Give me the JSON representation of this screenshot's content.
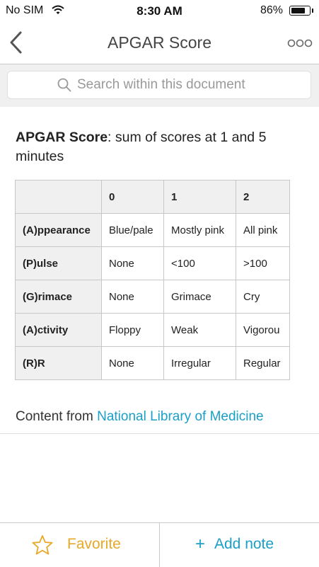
{
  "status_bar": {
    "carrier": "No SIM",
    "time": "8:30 AM",
    "battery_percent": "86%",
    "battery_level": 0.86,
    "wifi_icon": "wifi-icon"
  },
  "nav": {
    "title": "APGAR Score",
    "back_icon": "chevron-left-icon",
    "more_icon": "more-icon"
  },
  "search": {
    "placeholder": "Search within this document",
    "icon": "search-icon"
  },
  "heading": {
    "bold": "APGAR Score",
    "rest": ": sum of scores at 1 and 5 minutes"
  },
  "table": {
    "headers": [
      "",
      "0",
      "1",
      "2"
    ],
    "rows": [
      [
        "(A)ppearance",
        "Blue/pale",
        "Mostly pink",
        "All pink"
      ],
      [
        "(P)ulse",
        "None",
        "<100",
        ">100"
      ],
      [
        "(G)rimace",
        "None",
        "Grimace",
        "Cry"
      ],
      [
        "(A)ctivity",
        "Floppy",
        "Weak",
        "Vigorou"
      ],
      [
        "(R)R",
        "None",
        "Irregular",
        "Regular"
      ]
    ]
  },
  "source": {
    "prefix": "Content from ",
    "link": "National Library of Medicine"
  },
  "toolbar": {
    "favorite_label": "Favorite",
    "favorite_icon": "star-icon",
    "add_note_label": "Add note",
    "add_note_icon": "+"
  },
  "colors": {
    "accent": "#1a9fc7",
    "favorite": "#e8a928",
    "search_bg": "#f0f0f0",
    "table_header_bg": "#f0f0f0"
  }
}
